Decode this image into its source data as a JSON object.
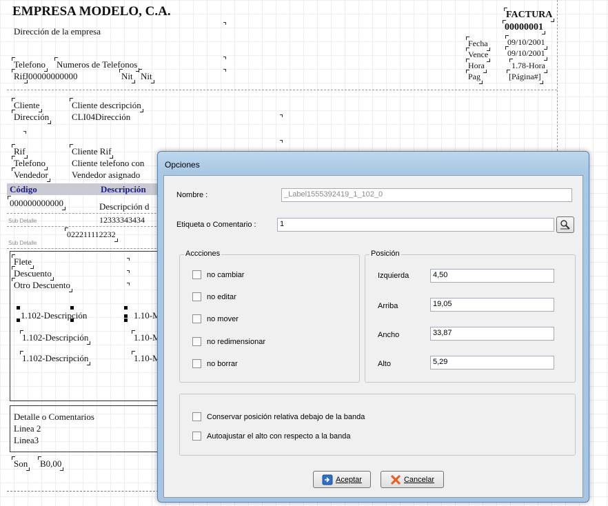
{
  "report": {
    "company": "EMPRESA MODELO, C.A.",
    "address": "Dirección de la empresa",
    "phone_label": "Telefono",
    "phone_value": "Numeros de Telefonos",
    "rif_label": "Rif",
    "rif_value": "J00000000000",
    "nit_label": "Nit",
    "nit_value": "Nit",
    "invoice_title": "FACTURA",
    "invoice_number": "00000001",
    "fecha_label": "Fecha",
    "fecha_value": "09/10/2001",
    "vence_label": "Vence",
    "vence_value": "09/10/2001",
    "hora_label": "Hora",
    "hora_value": "1.78-Hora",
    "pag_label": "Pag",
    "pag_value": "[Página#]",
    "cliente_label": "Cliente",
    "cliente_value": "Cliente descripción",
    "direccion_label": "Dirección",
    "direccion_value": "CLI04Dirección",
    "rif2_label": "Rif",
    "rif2_value": "Cliente Rif",
    "telefono2_label": "Telefono",
    "telefono2_value": "Cliente telefono con",
    "vendedor_label": "Vendedor",
    "vendedor_value": "Vendedor asignado",
    "col_codigo": "Código",
    "col_descripcion": "Descripción",
    "row_code": "000000000000",
    "row_desc": "Descripción d",
    "sub_detail_1": "Sub Detalle",
    "sub_value_1": "12333343434",
    "sub_detail_2": "Sub Detalle",
    "sub_value_2": "022211112232",
    "flete": "Flete",
    "descuento": "Descuento",
    "otro_descuento": "Otro Descuento",
    "desc_1": "1.102-Descripción",
    "desc_2": "1.102-Descripción",
    "desc_3": "1.102-Descripción",
    "val_1": "1.10-M",
    "val_2": "1.10-M",
    "val_3": "1.10-M",
    "detalle": "Detalle o Comentarios",
    "linea2": "Linea 2",
    "linea3": "Linea3",
    "son_label": "Son",
    "son_value": "B0,00"
  },
  "dialog": {
    "title": "Opciones",
    "nombre_label": "Nombre :",
    "nombre_value": "_Label1555392419_1_102_0",
    "etiqueta_label": "Etiqueta o Comentario :",
    "etiqueta_value": "1",
    "acciones_title": "Accciones",
    "acciones": [
      "no cambiar",
      "no editar",
      "no mover",
      "no redimensionar",
      "no borrar"
    ],
    "posicion_title": "Posición",
    "izquierda_label": "Izquierda",
    "izquierda_value": "4,50",
    "arriba_label": "Arriba",
    "arriba_value": "19,05",
    "ancho_label": "Ancho",
    "ancho_value": "33,87",
    "alto_label": "Alto",
    "alto_value": "5,29",
    "option_1": "Conservar posición relativa debajo de la banda",
    "option_2": "Autoajustar el alto con respecto a la banda",
    "accept_label": "Aceptar",
    "cancel_label": "Cancelar"
  },
  "colors": {
    "header_row_bg": "#c9cad4",
    "header_row_text": "#1d1d82",
    "dialog_frame": "#a9c8e4",
    "dialog_body": "#f0f0f0"
  }
}
